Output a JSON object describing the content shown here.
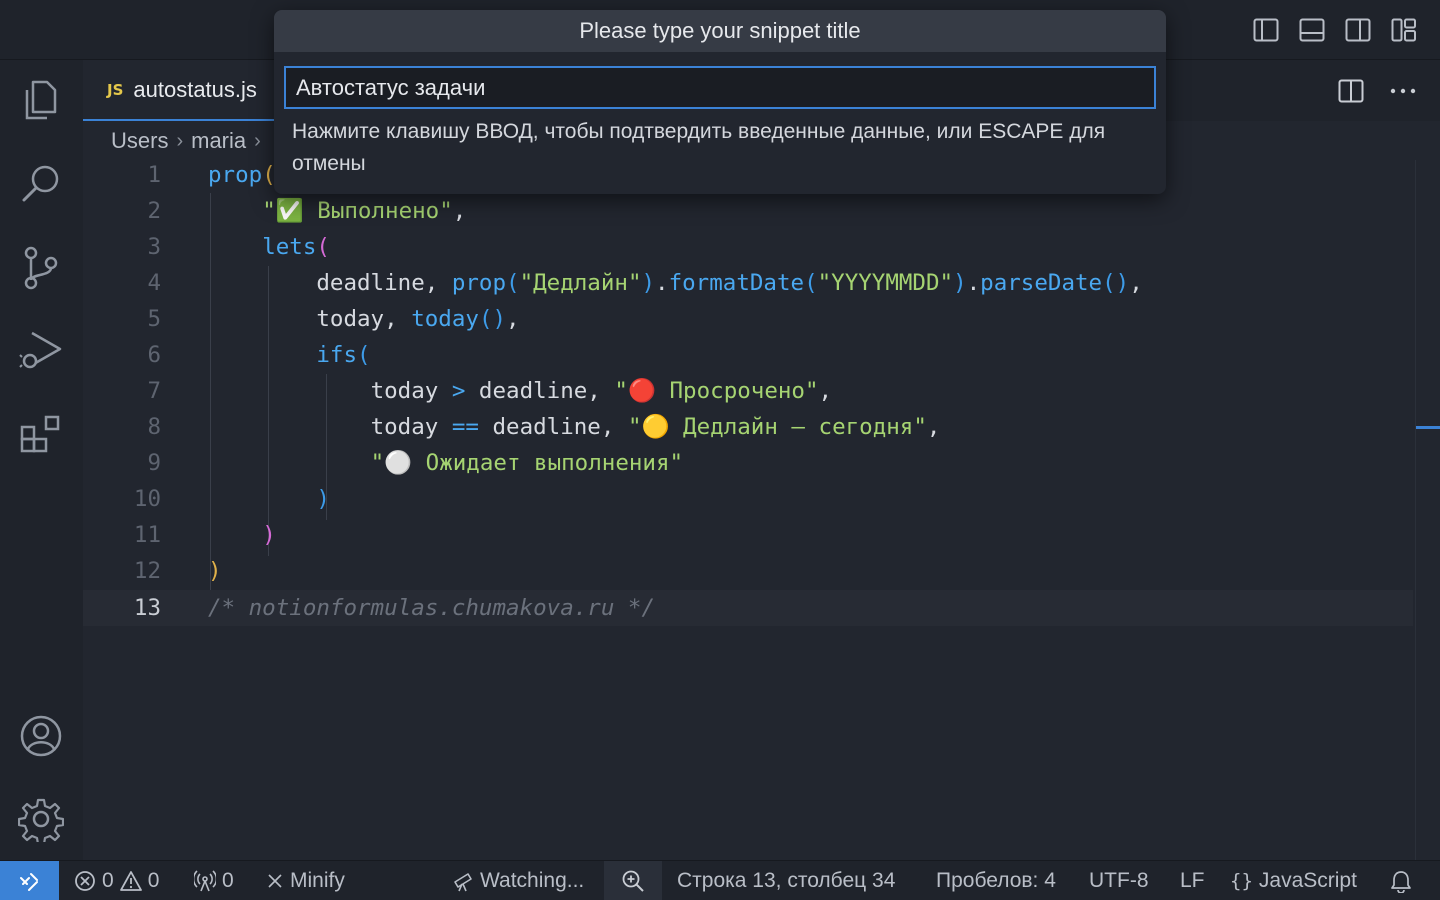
{
  "window": {
    "layout_icons": [
      "toggle-primary-sidebar-icon",
      "toggle-panel-icon",
      "toggle-secondary-sidebar-icon",
      "customize-layout-icon"
    ]
  },
  "activity_bar": {
    "items": [
      "explorer-icon",
      "search-icon",
      "source-control-icon",
      "run-debug-icon",
      "extensions-icon"
    ],
    "bottom": [
      "accounts-icon",
      "settings-gear-icon"
    ]
  },
  "tab": {
    "lang_badge": "JS",
    "label": "autostatus.js",
    "actions": [
      "split-editor-icon",
      "more-actions-icon"
    ]
  },
  "breadcrumb": {
    "segments": [
      "Users",
      "maria"
    ]
  },
  "editor": {
    "line_numbers": [
      "1",
      "2",
      "3",
      "4",
      "5",
      "6",
      "7",
      "8",
      "9",
      "10",
      "11",
      "12",
      "13"
    ],
    "current_line": 13
  },
  "quick_input": {
    "title": "Please type your snippet title",
    "value": "Автостатус задачи",
    "message": "Нажмите клавишу ВВОД, чтобы подтвердить введенные данные, или ESCAPE для отмены"
  },
  "status_bar": {
    "errors": "0",
    "warnings": "0",
    "ports": "0",
    "minify": "Minify",
    "watching": "Watching...",
    "position": "Строка 13, столбец 34",
    "indent": "Пробелов: 4",
    "encoding": "UTF-8",
    "eol": "LF",
    "language": "JavaScript"
  },
  "colors": {
    "accent": "#3b82d6",
    "background": "#22262f",
    "string": "#a6d472",
    "function": "#4aa8f0"
  }
}
